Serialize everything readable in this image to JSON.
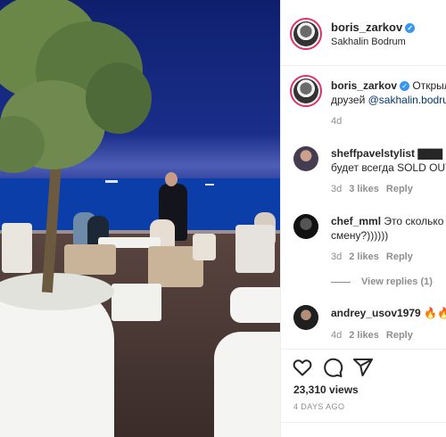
{
  "post": {
    "author": {
      "username": "boris_zarkov",
      "location": "Sakhalin Bodrum"
    },
    "caption": {
      "username": "boris_zarkov",
      "text_line1": "Открыл",
      "text_line2_prefix": "друзей ",
      "mention": "@sakhalin.bodrum",
      "time": "4d"
    },
    "comments": [
      {
        "username": "sheffpavelstylist",
        "text_line1": "▇▇▇",
        "text_line2": "будет всегда SOLD OUT",
        "time": "3d",
        "likes": "3 likes",
        "reply": "Reply"
      },
      {
        "username": "chef_mml",
        "text_line1": "Это сколько",
        "text_line2": "смену?))))))",
        "time": "3d",
        "likes": "2 likes",
        "reply": "Reply",
        "view_replies": "View replies (1)"
      },
      {
        "username": "andrey_usov1979",
        "text_line1": "🔥🔥",
        "time": "4d",
        "likes": "2 likes",
        "reply": "Reply"
      }
    ],
    "stats": {
      "views": "23,310 views",
      "ago": "4 DAYS AGO"
    }
  },
  "icons": {
    "like": "heart-icon",
    "comment": "comment-icon",
    "share": "share-icon",
    "verified": "verified-badge-icon"
  },
  "colors": {
    "verified": "#3897f0",
    "link": "#00376b",
    "muted": "#8e8e8e",
    "story_ring": "#e1306c"
  }
}
